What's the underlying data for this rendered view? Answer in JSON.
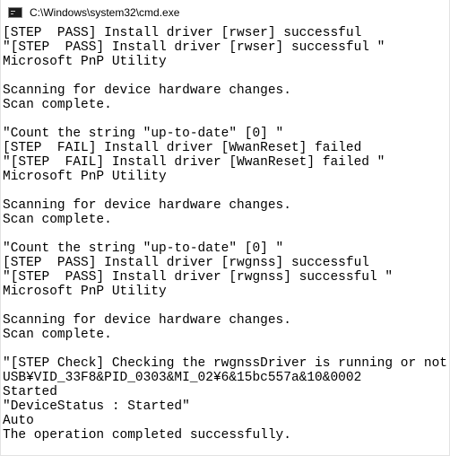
{
  "window": {
    "title": "C:\\Windows\\system32\\cmd.exe",
    "icon": "cmd-icon"
  },
  "console": {
    "lines": [
      "[STEP  PASS] Install driver [rwser] successful",
      "\"[STEP  PASS] Install driver [rwser] successful \"",
      "Microsoft PnP Utility",
      "",
      "Scanning for device hardware changes.",
      "Scan complete.",
      "",
      "\"Count the string \"up-to-date\" [0] \"",
      "[STEP  FAIL] Install driver [WwanReset] failed",
      "\"[STEP  FAIL] Install driver [WwanReset] failed \"",
      "Microsoft PnP Utility",
      "",
      "Scanning for device hardware changes.",
      "Scan complete.",
      "",
      "\"Count the string \"up-to-date\" [0] \"",
      "[STEP  PASS] Install driver [rwgnss] successful",
      "\"[STEP  PASS] Install driver [rwgnss] successful \"",
      "Microsoft PnP Utility",
      "",
      "Scanning for device hardware changes.",
      "Scan complete.",
      "",
      "\"[STEP Check] Checking the rwgnssDriver is running or not \"",
      "USB¥VID_33F8&PID_0303&MI_02¥6&15bc557a&10&0002",
      "Started",
      "\"DeviceStatus : Started\"",
      "Auto",
      "The operation completed successfully."
    ]
  }
}
